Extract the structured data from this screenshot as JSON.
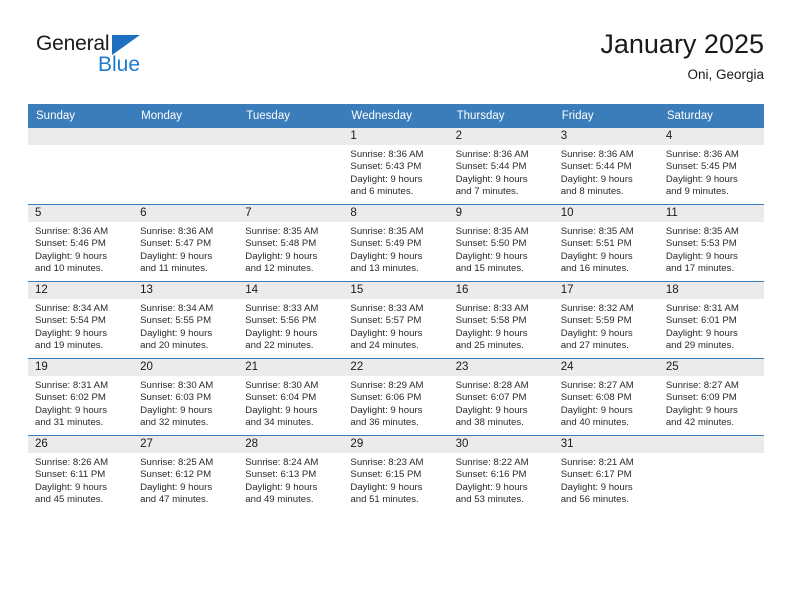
{
  "brand": {
    "name_top": "General",
    "name_bottom": "Blue",
    "color_blue": "#1f7ad1",
    "triangle_color": "#1f6fc0"
  },
  "header": {
    "title": "January 2025",
    "subtitle": "Oni, Georgia"
  },
  "theme": {
    "header_row_bg": "#3b7cba",
    "daynum_band_bg": "#ebebeb",
    "grid_line": "#3b7cba"
  },
  "weekday_headers": [
    "Sunday",
    "Monday",
    "Tuesday",
    "Wednesday",
    "Thursday",
    "Friday",
    "Saturday"
  ],
  "labels": {
    "sunrise_prefix": "Sunrise:",
    "sunset_prefix": "Sunset:",
    "daylight_prefix": "Daylight:"
  },
  "weeks": [
    [
      {
        "day": "",
        "empty": true,
        "line1": "",
        "line2": "",
        "line3": "",
        "line4": ""
      },
      {
        "day": "",
        "empty": true,
        "line1": "",
        "line2": "",
        "line3": "",
        "line4": ""
      },
      {
        "day": "",
        "empty": true,
        "line1": "",
        "line2": "",
        "line3": "",
        "line4": ""
      },
      {
        "day": "1",
        "empty": false,
        "line1": "Sunrise: 8:36 AM",
        "line2": "Sunset: 5:43 PM",
        "line3": "Daylight: 9 hours",
        "line4": "and 6 minutes."
      },
      {
        "day": "2",
        "empty": false,
        "line1": "Sunrise: 8:36 AM",
        "line2": "Sunset: 5:44 PM",
        "line3": "Daylight: 9 hours",
        "line4": "and 7 minutes."
      },
      {
        "day": "3",
        "empty": false,
        "line1": "Sunrise: 8:36 AM",
        "line2": "Sunset: 5:44 PM",
        "line3": "Daylight: 9 hours",
        "line4": "and 8 minutes."
      },
      {
        "day": "4",
        "empty": false,
        "line1": "Sunrise: 8:36 AM",
        "line2": "Sunset: 5:45 PM",
        "line3": "Daylight: 9 hours",
        "line4": "and 9 minutes."
      }
    ],
    [
      {
        "day": "5",
        "empty": false,
        "line1": "Sunrise: 8:36 AM",
        "line2": "Sunset: 5:46 PM",
        "line3": "Daylight: 9 hours",
        "line4": "and 10 minutes."
      },
      {
        "day": "6",
        "empty": false,
        "line1": "Sunrise: 8:36 AM",
        "line2": "Sunset: 5:47 PM",
        "line3": "Daylight: 9 hours",
        "line4": "and 11 minutes."
      },
      {
        "day": "7",
        "empty": false,
        "line1": "Sunrise: 8:35 AM",
        "line2": "Sunset: 5:48 PM",
        "line3": "Daylight: 9 hours",
        "line4": "and 12 minutes."
      },
      {
        "day": "8",
        "empty": false,
        "line1": "Sunrise: 8:35 AM",
        "line2": "Sunset: 5:49 PM",
        "line3": "Daylight: 9 hours",
        "line4": "and 13 minutes."
      },
      {
        "day": "9",
        "empty": false,
        "line1": "Sunrise: 8:35 AM",
        "line2": "Sunset: 5:50 PM",
        "line3": "Daylight: 9 hours",
        "line4": "and 15 minutes."
      },
      {
        "day": "10",
        "empty": false,
        "line1": "Sunrise: 8:35 AM",
        "line2": "Sunset: 5:51 PM",
        "line3": "Daylight: 9 hours",
        "line4": "and 16 minutes."
      },
      {
        "day": "11",
        "empty": false,
        "line1": "Sunrise: 8:35 AM",
        "line2": "Sunset: 5:53 PM",
        "line3": "Daylight: 9 hours",
        "line4": "and 17 minutes."
      }
    ],
    [
      {
        "day": "12",
        "empty": false,
        "line1": "Sunrise: 8:34 AM",
        "line2": "Sunset: 5:54 PM",
        "line3": "Daylight: 9 hours",
        "line4": "and 19 minutes."
      },
      {
        "day": "13",
        "empty": false,
        "line1": "Sunrise: 8:34 AM",
        "line2": "Sunset: 5:55 PM",
        "line3": "Daylight: 9 hours",
        "line4": "and 20 minutes."
      },
      {
        "day": "14",
        "empty": false,
        "line1": "Sunrise: 8:33 AM",
        "line2": "Sunset: 5:56 PM",
        "line3": "Daylight: 9 hours",
        "line4": "and 22 minutes."
      },
      {
        "day": "15",
        "empty": false,
        "line1": "Sunrise: 8:33 AM",
        "line2": "Sunset: 5:57 PM",
        "line3": "Daylight: 9 hours",
        "line4": "and 24 minutes."
      },
      {
        "day": "16",
        "empty": false,
        "line1": "Sunrise: 8:33 AM",
        "line2": "Sunset: 5:58 PM",
        "line3": "Daylight: 9 hours",
        "line4": "and 25 minutes."
      },
      {
        "day": "17",
        "empty": false,
        "line1": "Sunrise: 8:32 AM",
        "line2": "Sunset: 5:59 PM",
        "line3": "Daylight: 9 hours",
        "line4": "and 27 minutes."
      },
      {
        "day": "18",
        "empty": false,
        "line1": "Sunrise: 8:31 AM",
        "line2": "Sunset: 6:01 PM",
        "line3": "Daylight: 9 hours",
        "line4": "and 29 minutes."
      }
    ],
    [
      {
        "day": "19",
        "empty": false,
        "line1": "Sunrise: 8:31 AM",
        "line2": "Sunset: 6:02 PM",
        "line3": "Daylight: 9 hours",
        "line4": "and 31 minutes."
      },
      {
        "day": "20",
        "empty": false,
        "line1": "Sunrise: 8:30 AM",
        "line2": "Sunset: 6:03 PM",
        "line3": "Daylight: 9 hours",
        "line4": "and 32 minutes."
      },
      {
        "day": "21",
        "empty": false,
        "line1": "Sunrise: 8:30 AM",
        "line2": "Sunset: 6:04 PM",
        "line3": "Daylight: 9 hours",
        "line4": "and 34 minutes."
      },
      {
        "day": "22",
        "empty": false,
        "line1": "Sunrise: 8:29 AM",
        "line2": "Sunset: 6:06 PM",
        "line3": "Daylight: 9 hours",
        "line4": "and 36 minutes."
      },
      {
        "day": "23",
        "empty": false,
        "line1": "Sunrise: 8:28 AM",
        "line2": "Sunset: 6:07 PM",
        "line3": "Daylight: 9 hours",
        "line4": "and 38 minutes."
      },
      {
        "day": "24",
        "empty": false,
        "line1": "Sunrise: 8:27 AM",
        "line2": "Sunset: 6:08 PM",
        "line3": "Daylight: 9 hours",
        "line4": "and 40 minutes."
      },
      {
        "day": "25",
        "empty": false,
        "line1": "Sunrise: 8:27 AM",
        "line2": "Sunset: 6:09 PM",
        "line3": "Daylight: 9 hours",
        "line4": "and 42 minutes."
      }
    ],
    [
      {
        "day": "26",
        "empty": false,
        "line1": "Sunrise: 8:26 AM",
        "line2": "Sunset: 6:11 PM",
        "line3": "Daylight: 9 hours",
        "line4": "and 45 minutes."
      },
      {
        "day": "27",
        "empty": false,
        "line1": "Sunrise: 8:25 AM",
        "line2": "Sunset: 6:12 PM",
        "line3": "Daylight: 9 hours",
        "line4": "and 47 minutes."
      },
      {
        "day": "28",
        "empty": false,
        "line1": "Sunrise: 8:24 AM",
        "line2": "Sunset: 6:13 PM",
        "line3": "Daylight: 9 hours",
        "line4": "and 49 minutes."
      },
      {
        "day": "29",
        "empty": false,
        "line1": "Sunrise: 8:23 AM",
        "line2": "Sunset: 6:15 PM",
        "line3": "Daylight: 9 hours",
        "line4": "and 51 minutes."
      },
      {
        "day": "30",
        "empty": false,
        "line1": "Sunrise: 8:22 AM",
        "line2": "Sunset: 6:16 PM",
        "line3": "Daylight: 9 hours",
        "line4": "and 53 minutes."
      },
      {
        "day": "31",
        "empty": false,
        "line1": "Sunrise: 8:21 AM",
        "line2": "Sunset: 6:17 PM",
        "line3": "Daylight: 9 hours",
        "line4": "and 56 minutes."
      },
      {
        "day": "",
        "empty": true,
        "line1": "",
        "line2": "",
        "line3": "",
        "line4": ""
      }
    ]
  ]
}
